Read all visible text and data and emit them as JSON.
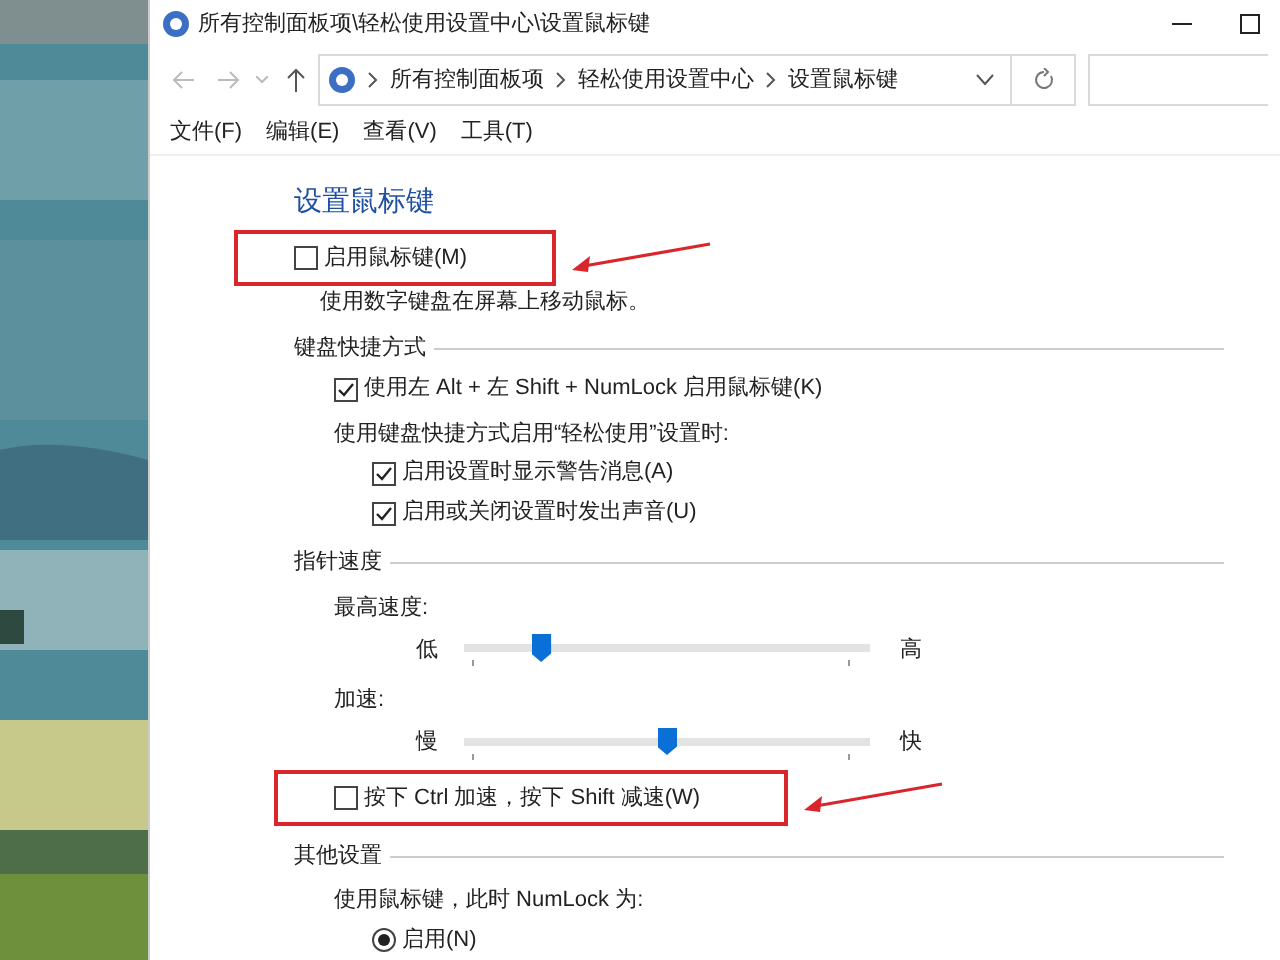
{
  "window": {
    "title": "所有控制面板项\\轻松使用设置中心\\设置鼠标键"
  },
  "address_bar": {
    "breadcrumbs": [
      "所有控制面板项",
      "轻松使用设置中心",
      "设置鼠标键"
    ]
  },
  "menu": [
    "文件(F)",
    "编辑(E)",
    "查看(V)",
    "工具(T)"
  ],
  "heading": "设置鼠标键",
  "main_option": {
    "label": "启用鼠标键(M)",
    "checked": false,
    "highlighted": true
  },
  "main_note": "使用数字键盘在屏幕上移动鼠标。",
  "sections": [
    {
      "title": "键盘快捷方式",
      "items": [
        {
          "kind": "checkbox",
          "label": "使用左 Alt + 左 Shift + NumLock 启用鼠标键(K)",
          "checked": true,
          "highlighted": false
        },
        {
          "kind": "group",
          "label": "使用键盘快捷方式启用“轻松使用”设置时:",
          "children": [
            {
              "kind": "checkbox",
              "label": "启用设置时显示警告消息(A)",
              "checked": true,
              "highlighted": false
            },
            {
              "kind": "checkbox",
              "label": "启用或关闭设置时发出声音(U)",
              "checked": true,
              "highlighted": false
            }
          ]
        }
      ]
    },
    {
      "title": "指针速度",
      "items": [
        {
          "kind": "slider",
          "label": "最高速度:",
          "min_label": "低",
          "max_label": "高",
          "level": 0.19
        },
        {
          "kind": "slider",
          "label": "加速:",
          "min_label": "慢",
          "max_label": "快",
          "level": 0.5
        },
        {
          "kind": "checkbox",
          "label": "按下 Ctrl 加速，按下 Shift 减速(W)",
          "checked": false,
          "highlighted": true
        }
      ]
    },
    {
      "title": "其他设置",
      "items": [
        {
          "kind": "group",
          "label": "使用鼠标键，此时 NumLock 为:",
          "children": [
            {
              "kind": "radio",
              "label": "启用(N)",
              "selected": true
            }
          ]
        }
      ]
    }
  ]
}
